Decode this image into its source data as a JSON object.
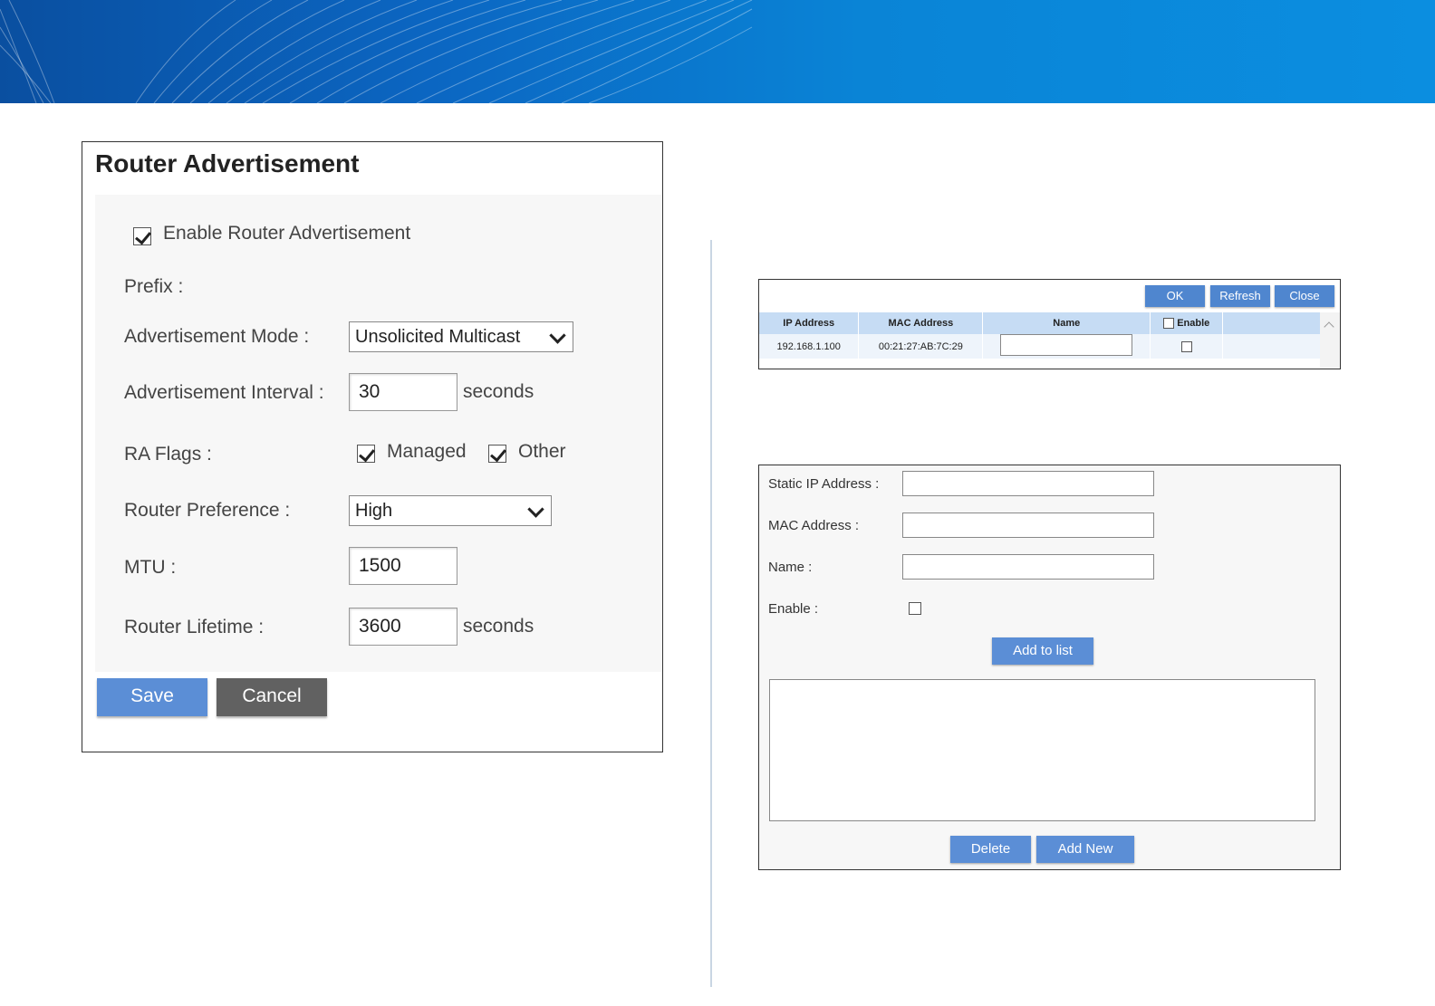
{
  "router_adv": {
    "title": "Router Advertisement",
    "enable_label": "Enable Router Advertisement",
    "enable_checked": true,
    "prefix_label": "Prefix :",
    "mode_label": "Advertisement Mode :",
    "mode_value": "Unsolicited Multicast",
    "interval_label": "Advertisement Interval :",
    "interval_value": "30",
    "interval_unit": "seconds",
    "flags_label": "RA Flags :",
    "managed_label": "Managed",
    "managed_checked": true,
    "other_label": "Other",
    "other_checked": true,
    "preference_label": "Router Preference :",
    "preference_value": "High",
    "mtu_label": "MTU :",
    "mtu_value": "1500",
    "lifetime_label": "Router Lifetime :",
    "lifetime_value": "3600",
    "lifetime_unit": "seconds",
    "save_label": "Save",
    "cancel_label": "Cancel"
  },
  "client_list": {
    "ok_label": "OK",
    "refresh_label": "Refresh",
    "close_label": "Close",
    "columns": {
      "ip": "IP Address",
      "mac": "MAC Address",
      "name": "Name",
      "enable": "Enable"
    },
    "rows": [
      {
        "ip": "192.168.1.100",
        "mac": "00:21:27:AB:7C:29"
      }
    ]
  },
  "static_lease": {
    "ip_label": "Static IP Address :",
    "mac_label": "MAC Address :",
    "name_label": "Name :",
    "enable_label": "Enable :",
    "add_to_list_label": "Add to list",
    "delete_label": "Delete",
    "add_new_label": "Add New"
  },
  "colors": {
    "banner_blue": "#0b7fd6",
    "button_blue": "#5b8ed6",
    "button_gray": "#616161",
    "table_header": "#c6dcf4"
  }
}
